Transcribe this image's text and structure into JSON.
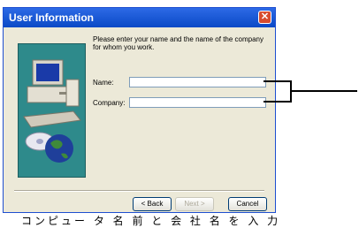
{
  "window": {
    "title": "User Information"
  },
  "title_bar": {
    "close_glyph": "✕"
  },
  "main": {
    "prompt": "Please enter your name and the name of the company for whom you work.",
    "name_label": "Name:",
    "company_label": "Company:",
    "name_value": "",
    "company_value": ""
  },
  "footer": {
    "back_label": "< Back",
    "next_label": "Next >",
    "cancel_label": "Cancel"
  },
  "caption": "コンピュー タ 名 前 と 会 社 名 を 入 力",
  "colors": {
    "titlebar": "#0a49c6",
    "panel": "#2e8a8b",
    "dialog_bg": "#ece9d8"
  }
}
